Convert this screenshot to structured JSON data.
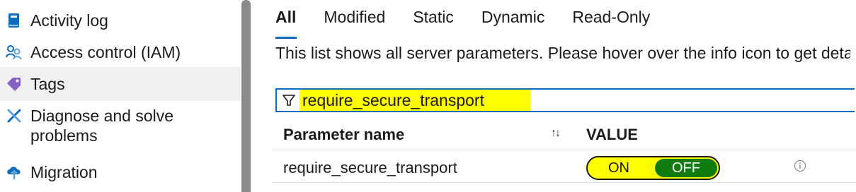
{
  "sidebar": {
    "items": [
      {
        "label": "Activity log",
        "icon": "activity-log-icon"
      },
      {
        "label": "Access control (IAM)",
        "icon": "access-control-icon"
      },
      {
        "label": "Tags",
        "icon": "tag-icon"
      },
      {
        "label": "Diagnose and solve\nproblems",
        "icon": "diagnose-icon"
      },
      {
        "label": "Migration",
        "icon": "migration-icon"
      }
    ],
    "selected": "Tags"
  },
  "tabs": [
    {
      "label": "All",
      "active": true
    },
    {
      "label": "Modified",
      "active": false
    },
    {
      "label": "Static",
      "active": false
    },
    {
      "label": "Dynamic",
      "active": false
    },
    {
      "label": "Read-Only",
      "active": false
    }
  ],
  "description": "This list shows all server parameters. Please hover over the info icon to get deta",
  "filter": {
    "value": "require_secure_transport",
    "icon": "filter-icon"
  },
  "table": {
    "columns": [
      "Parameter name",
      "VALUE"
    ],
    "rows": [
      {
        "name": "require_secure_transport",
        "toggle_on": "ON",
        "toggle_off": "OFF",
        "selected": "OFF"
      }
    ]
  },
  "colors": {
    "accent": "#0f6cbd",
    "highlight": "#ffff00",
    "toggle_active": "#107c10"
  }
}
